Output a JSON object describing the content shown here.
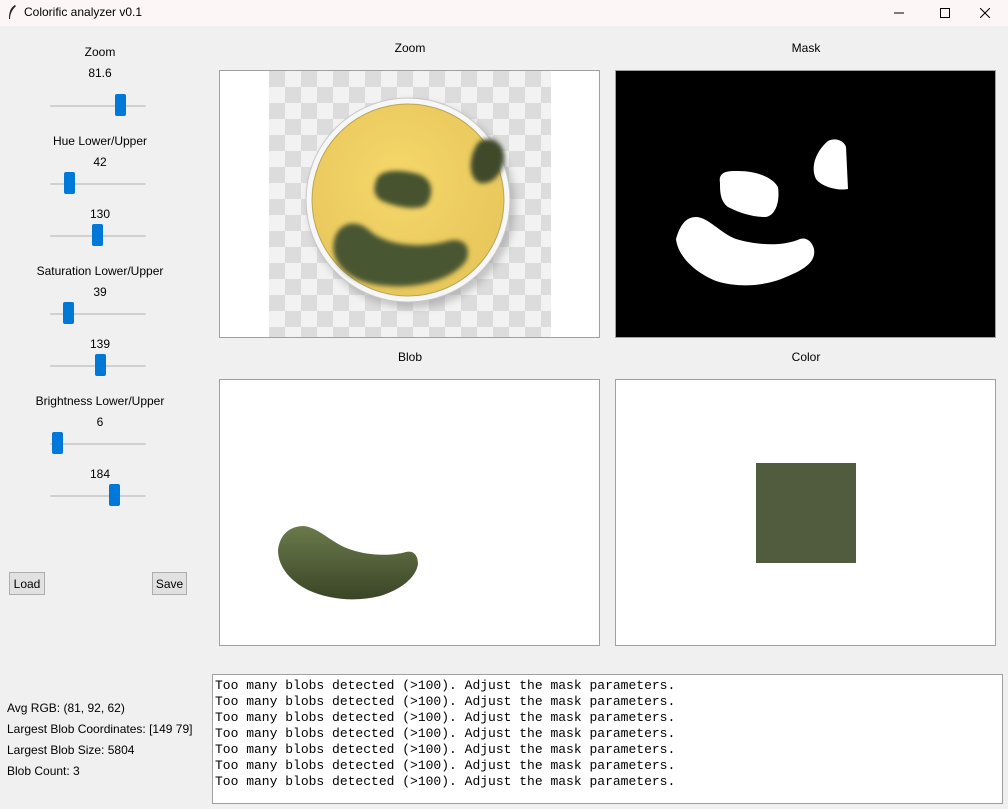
{
  "window": {
    "title": "Colorific analyzer v0.1"
  },
  "controls": {
    "zoom": {
      "label": "Zoom",
      "value": "81.6",
      "level": 0.76
    },
    "hue": {
      "label": "Hue Lower/Upper",
      "lower": "42",
      "upper": "130",
      "lower_level": 0.16,
      "upper_level": 0.49
    },
    "saturation": {
      "label": "Saturation Lower/Upper",
      "lower": "39",
      "upper": "139",
      "lower_level": 0.15,
      "upper_level": 0.53
    },
    "brightness": {
      "label": "Brightness Lower/Upper",
      "lower": "6",
      "upper": "184",
      "lower_level": 0.02,
      "upper_level": 0.7
    },
    "load_label": "Load",
    "save_label": "Save"
  },
  "panels": {
    "zoom": "Zoom",
    "mask": "Mask",
    "blob": "Blob",
    "color": "Color"
  },
  "colors": {
    "avg": "#515c3e",
    "slider_thumb": "#0078d7"
  },
  "stats": {
    "avg_rgb": "Avg RGB: (81, 92, 62)",
    "largest_blob_coords": "Largest Blob Coordinates: [149  79]",
    "largest_blob_size": "Largest Blob Size: 5804",
    "blob_count": "Blob Count: 3"
  },
  "log": [
    "Too many blobs detected (>100). Adjust the mask parameters.",
    "Too many blobs detected (>100). Adjust the mask parameters.",
    "Too many blobs detected (>100). Adjust the mask parameters.",
    "Too many blobs detected (>100). Adjust the mask parameters.",
    "Too many blobs detected (>100). Adjust the mask parameters.",
    "Too many blobs detected (>100). Adjust the mask parameters.",
    "Too many blobs detected (>100). Adjust the mask parameters."
  ]
}
